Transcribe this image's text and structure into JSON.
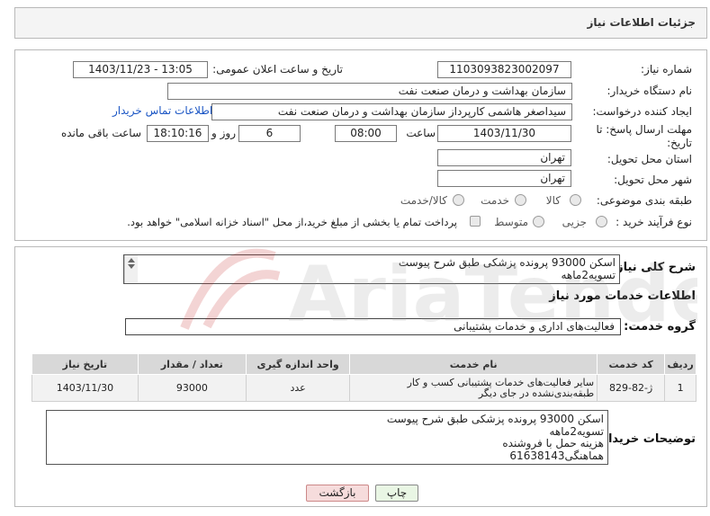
{
  "header": {
    "title": "جزئیات اطلاعات نیاز"
  },
  "fields": {
    "need_number_label": "شماره نیاز:",
    "need_number": "1103093823002097",
    "announce_label": "تاریخ و ساعت اعلان عمومی:",
    "announce_value": "1403/11/23 - 13:05",
    "buyer_org_label": "نام دستگاه خریدار:",
    "buyer_org": "سازمان بهداشت و درمان صنعت نفت",
    "creator_label": "ایجاد کننده درخواست:",
    "creator": "سیداصغر هاشمی کارپرداز سازمان بهداشت و درمان صنعت نفت",
    "contact_link": "اطلاعات تماس خریدار",
    "deadline_label_1": "مهلت ارسال پاسخ: تا",
    "deadline_label_2": "تاریخ:",
    "deadline_date": "1403/11/30",
    "time_label": "ساعت",
    "deadline_time": "08:00",
    "days_value": "6",
    "days_label": "روز و",
    "remaining_time": "18:10:16",
    "remaining_label": "ساعت باقی مانده",
    "province_label": "استان محل تحویل:",
    "province": "تهران",
    "city_label": "شهر محل تحویل:",
    "city": "تهران",
    "category_label": "طبقه بندی موضوعی:",
    "category_options": [
      "کالا",
      "خدمت",
      "کالا/خدمت"
    ],
    "process_label": "نوع فرآیند خرید :",
    "process_options": [
      "جزیی",
      "متوسط"
    ],
    "payment_note": "پرداخت تمام یا بخشی از مبلغ خرید،از محل \"اسناد خزانه اسلامی\" خواهد بود."
  },
  "summary": {
    "label": "شرح کلی نیاز:",
    "text": "اسکن 93000 پرونده پزشکی طبق شرح پیوست\nتسویه2ماهه"
  },
  "services": {
    "section_title": "اطلاعات خدمات مورد نیاز",
    "group_label": "گروه خدمت:",
    "group_value": "فعالیت‌های اداری و خدمات پشتیبانی",
    "columns": [
      "ردیف",
      "کد خدمت",
      "نام خدمت",
      "واحد اندازه گیری",
      "تعداد / مقدار",
      "تاریخ نیاز"
    ],
    "rows": [
      [
        "1",
        "ژ-82-829",
        "سایر فعالیت‌های خدمات پشتیبانی کسب و کار طبقه‌بندی‌نشده در جای دیگر",
        "عدد",
        "93000",
        "1403/11/30"
      ]
    ]
  },
  "buyer_notes": {
    "label": "توضیحات خریدار:",
    "text": "اسکن 93000 پرونده پزشکی طبق شرح پیوست\nتسویه2ماهه\nهزینه حمل با فروشنده\nهماهنگی61638143"
  },
  "buttons": {
    "print": "چاپ",
    "back": "بازگشت"
  },
  "watermark": {
    "text": "AriaTender.neT"
  },
  "colors": {
    "link": "#1a55c4",
    "back_button_bg": "#f6dcdc",
    "print_button_bg": "#e9f6e4",
    "watermark": "#c01818"
  }
}
